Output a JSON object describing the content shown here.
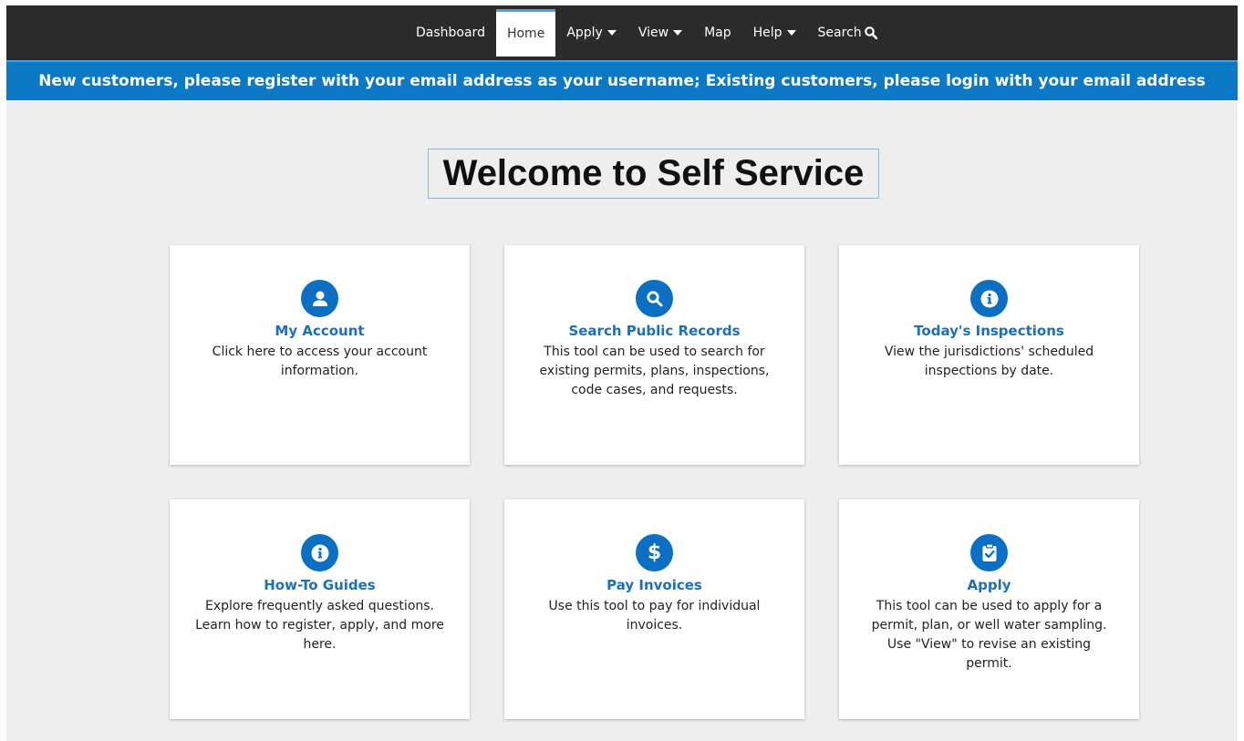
{
  "nav": {
    "items": [
      {
        "label": "Dashboard",
        "dropdown": false
      },
      {
        "label": "Home",
        "active": true
      },
      {
        "label": "Apply",
        "dropdown": true
      },
      {
        "label": "View",
        "dropdown": true
      },
      {
        "label": "Map",
        "dropdown": false
      },
      {
        "label": "Help",
        "dropdown": true
      },
      {
        "label": "Search",
        "icon": "search-icon"
      }
    ]
  },
  "banner": {
    "text": "New customers, please register with your email address as your username; Existing customers, please login with your email address"
  },
  "page": {
    "title": "Welcome to Self Service"
  },
  "cards": [
    {
      "icon": "user-icon",
      "title": "My Account",
      "description": "Click here to access your account information."
    },
    {
      "icon": "search-icon",
      "title": "Search Public Records",
      "description": "This tool can be used to search for existing permits, plans, inspections, code cases, and requests."
    },
    {
      "icon": "info-icon",
      "title": "Today's Inspections",
      "description": "View the jurisdictions' scheduled inspections by date."
    },
    {
      "icon": "info-icon",
      "title": "How-To Guides",
      "description": "Explore frequently asked questions. Learn how to register, apply, and more here."
    },
    {
      "icon": "dollar-icon",
      "title": "Pay Invoices",
      "description": "Use this tool to pay for individual invoices."
    },
    {
      "icon": "clipboard-check-icon",
      "title": "Apply",
      "description": "This tool can be used to apply for a permit, plan, or well water sampling. Use \"View\" to revise an existing permit."
    }
  ],
  "colors": {
    "nav_background": "#2b2b2b",
    "banner_background": "#0b79c6",
    "accent": "#0b6fc4",
    "link": "#1a6fbf",
    "page_background": "#eeeeee"
  }
}
